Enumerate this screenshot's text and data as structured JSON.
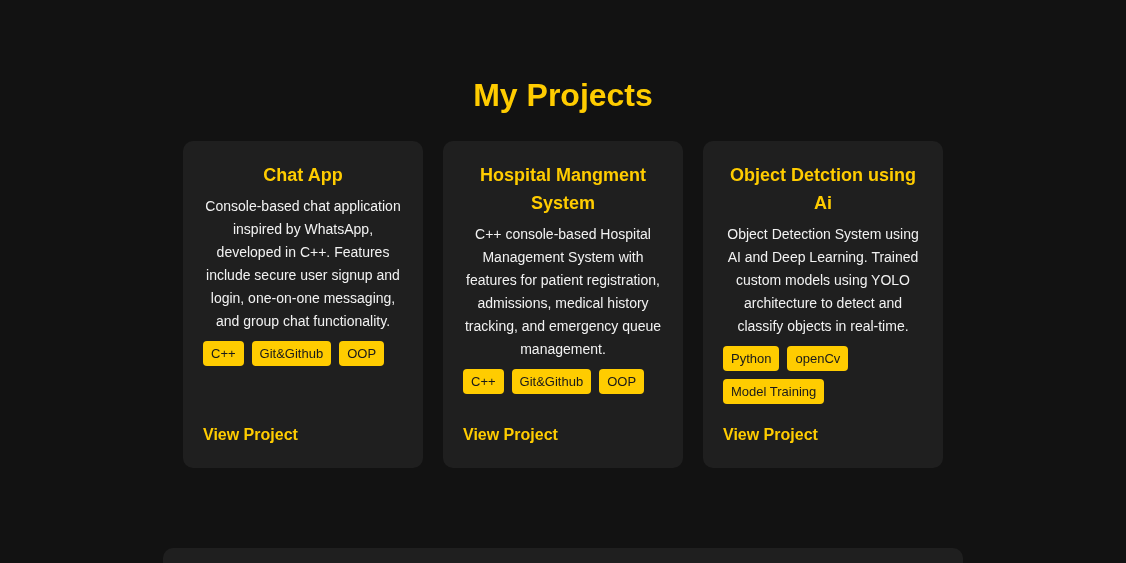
{
  "section": {
    "title": "My Projects"
  },
  "projects": [
    {
      "title": "Chat App",
      "description": "Console-based chat application inspired by WhatsApp, developed in C++. Features include secure user signup and login, one-on-one messaging, and group chat functionality.",
      "tags": [
        "C++",
        "Git&Github",
        "OOP"
      ],
      "link": "View Project"
    },
    {
      "title": "Hospital Mangment System",
      "description": "C++ console-based Hospital Management System with features for patient registration, admissions, medical history tracking, and emergency queue management.",
      "tags": [
        "C++",
        "Git&Github",
        "OOP"
      ],
      "link": "View Project"
    },
    {
      "title": "Object Detction using Ai",
      "description": "Object Detection System using AI and Deep Learning. Trained custom models using YOLO architecture to detect and classify objects in real-time.",
      "tags": [
        "Python",
        "openCv",
        "Model Training"
      ],
      "link": "View Project"
    }
  ]
}
